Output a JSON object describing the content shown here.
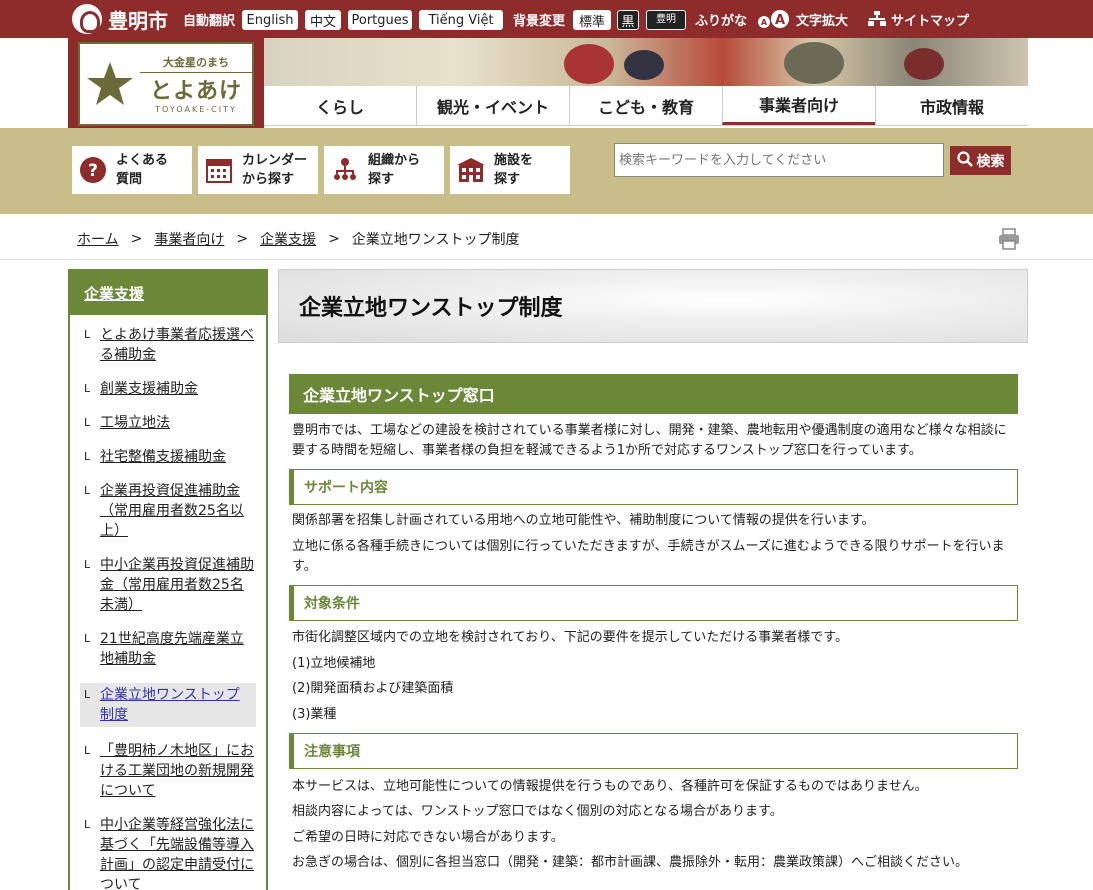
{
  "top_bar": {
    "city_name": "豊明市",
    "auto_translate": "自動翻訳",
    "languages": [
      "English",
      "中文",
      "Portgues",
      "Tiếng Việt"
    ],
    "bg_change": "背景変更",
    "bg_standard": "標準",
    "bg_black": "黒",
    "kana_badge": "豊明",
    "furigana": "ふりがな",
    "text_size_icon": "A-A",
    "text_enlarge": "文字拡大",
    "sitemap": "サイトマップ"
  },
  "logo": {
    "line1": "大金星のまち",
    "line2": "とよあけ",
    "line3": "TOYOAKE-CITY"
  },
  "global_nav": [
    "くらし",
    "観光・イベント",
    "こども・教育",
    "事業者向け",
    "市政情報"
  ],
  "tools": [
    {
      "label1": "よくある",
      "label2": "質問",
      "icon": "question-icon"
    },
    {
      "label1": "カレンダー",
      "label2": "から探す",
      "icon": "calendar-icon"
    },
    {
      "label1": "組織から",
      "label2": "探す",
      "icon": "org-chart-icon"
    },
    {
      "label1": "施設を",
      "label2": "探す",
      "icon": "facility-icon"
    }
  ],
  "search": {
    "placeholder": "検索キーワードを入力してください",
    "button": "検索"
  },
  "breadcrumb": [
    "ホーム",
    "事業者向け",
    "企業支援",
    "企業立地ワンストップ制度"
  ],
  "sidebar": {
    "title": "企業支援",
    "items": [
      "とよあけ事業者応援選べる補助金",
      "創業支援補助金",
      "工場立地法",
      "社宅整備支援補助金",
      "企業再投資促進補助金（常用雇用者数25名以上）",
      "中小企業再投資促進補助金（常用雇用者数25名未満）",
      "21世紀高度先端産業立地補助金",
      "企業立地ワンストップ制度",
      "「豊明柿ノ木地区」における工業団地の新規開発について",
      "中小企業等経営強化法に基づく「先端設備等導入計画」の認定申請受付について"
    ]
  },
  "main": {
    "title": "企業立地ワンストップ制度",
    "section_title": "企業立地ワンストップ窓口",
    "intro": "豊明市では、工場などの建設を検討されている事業者様に対し、開発・建築、農地転用や優遇制度の適用など様々な相談に要する時間を短縮し、事業者様の負担を軽減できるよう1か所で対応するワンストップ窓口を行っています。",
    "support_heading": "サポート内容",
    "support_p1": "関係部署を招集し計画されている用地への立地可能性や、補助制度について情報の提供を行います。",
    "support_p2": "立地に係る各種手続きについては個別に行っていただきますが、手続きがスムーズに進むようできる限りサポートを行います。",
    "target_heading": "対象条件",
    "target_p1": "市街化調整区域内での立地を検討されており、下記の要件を提示していただける事業者様です。",
    "target_items": [
      "(1)立地候補地",
      "(2)開発面積および建築面積",
      "(3)業種"
    ],
    "notes_heading": "注意事項",
    "notes": [
      "本サービスは、立地可能性についての情報提供を行うものであり、各種許可を保証するものではありません。",
      "相談内容によっては、ワンストップ窓口ではなく個別の対応となる場合があります。",
      "ご希望の日時に対応できない場合があります。",
      "お急ぎの場合は、個別に各担当窓口（開発・建築：都市計画課、農振除外・転用：農業政策課）へご相談ください。"
    ]
  },
  "colors": {
    "brand_red": "#8e2b2b",
    "accent_green": "#6a8838",
    "tool_band": "#c9bd8a"
  }
}
